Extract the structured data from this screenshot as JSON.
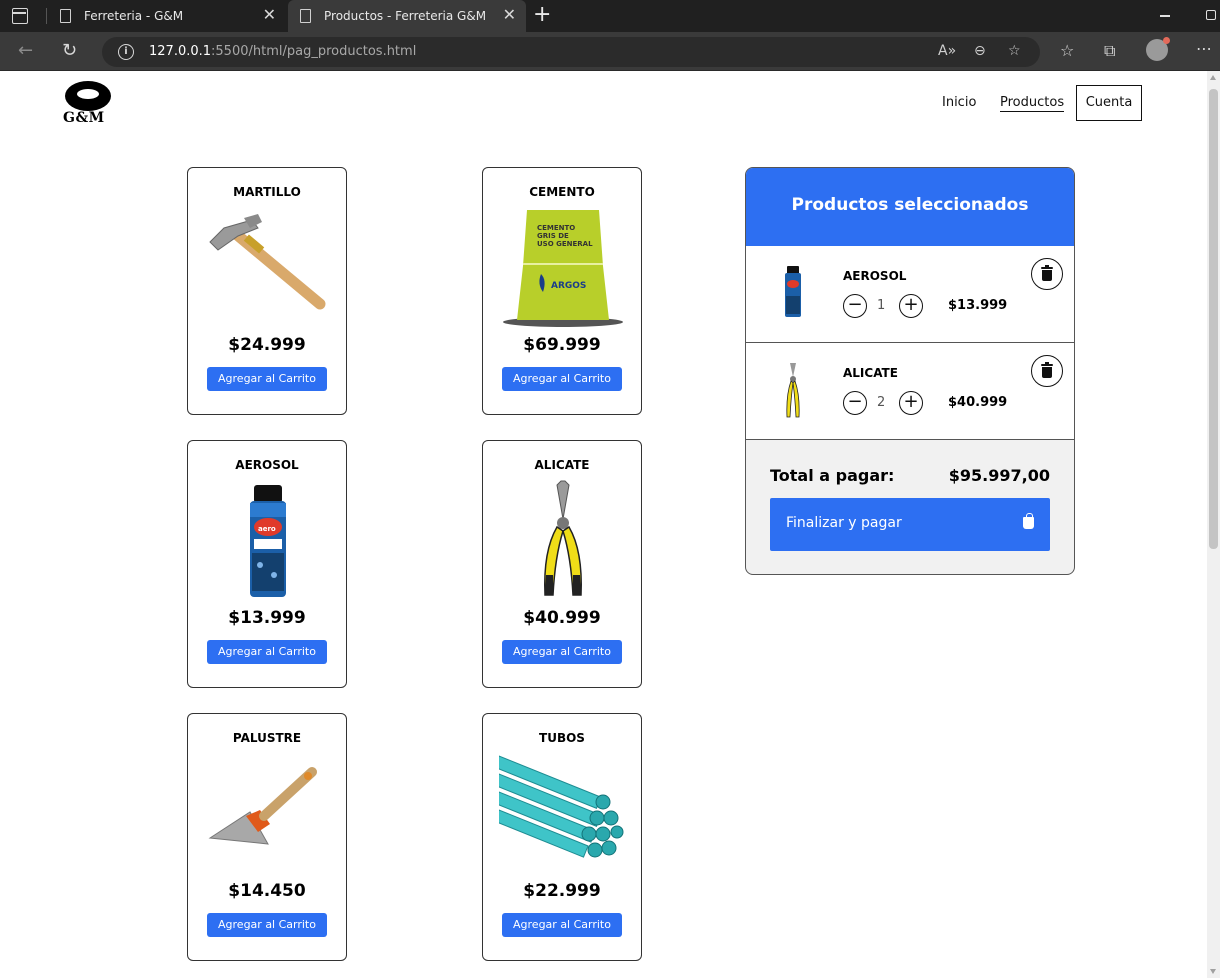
{
  "browser": {
    "tabs": [
      {
        "title": "Ferreteria - G&M"
      },
      {
        "title": "Productos - Ferreteria G&M"
      }
    ],
    "url_host": "127.0.0.1",
    "url_rest": ":5500/html/pag_productos.html"
  },
  "site": {
    "logo_text": "G&M",
    "nav": {
      "inicio": "Inicio",
      "productos": "Productos",
      "cuenta": "Cuenta"
    }
  },
  "products": [
    {
      "name": "MARTILLO",
      "price": "$24.999",
      "button": "Agregar al Carrito",
      "icon": "hammer-icon"
    },
    {
      "name": "CEMENTO",
      "price": "$69.999",
      "button": "Agregar al Carrito",
      "icon": "cement-bag-icon"
    },
    {
      "name": "AEROSOL",
      "price": "$13.999",
      "button": "Agregar al Carrito",
      "icon": "spray-can-icon"
    },
    {
      "name": "ALICATE",
      "price": "$40.999",
      "button": "Agregar al Carrito",
      "icon": "pliers-icon"
    },
    {
      "name": "PALUSTRE",
      "price": "$14.450",
      "button": "Agregar al Carrito",
      "icon": "trowel-icon"
    },
    {
      "name": "TUBOS",
      "price": "$22.999",
      "button": "Agregar al Carrito",
      "icon": "pipes-icon"
    }
  ],
  "cement_bag_text": {
    "line1": "CEMENTO",
    "line2": "GRIS DE",
    "line3": "USO GENERAL",
    "brand": "ARGOS"
  },
  "cart": {
    "title": "Productos seleccionados",
    "items": [
      {
        "name": "AEROSOL",
        "qty": "1",
        "price": "$13.999"
      },
      {
        "name": "ALICATE",
        "qty": "2",
        "price": "$40.999"
      }
    ],
    "total_label": "Total a pagar:",
    "total_value": "$95.997,00",
    "pay_label": "Finalizar y pagar"
  },
  "colors": {
    "accent": "#2d6ff2"
  }
}
